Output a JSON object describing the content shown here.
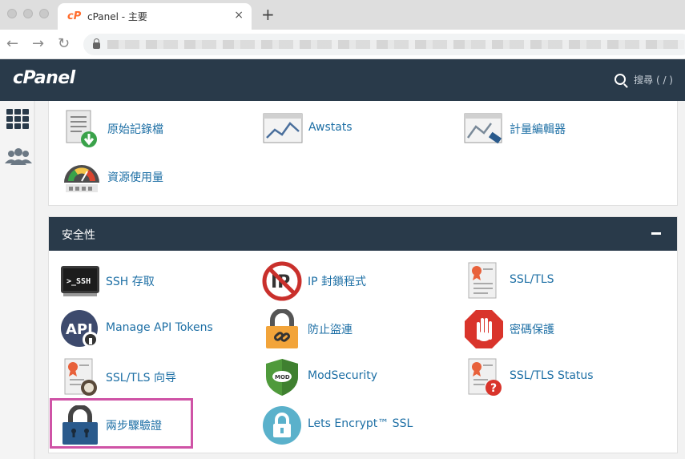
{
  "browser": {
    "tab_title": "cPanel - 主要",
    "tab_favicon": "cP",
    "tab_close": "×",
    "new_tab": "+",
    "nav": {
      "back": "←",
      "forward": "→",
      "reload": "↻"
    }
  },
  "header": {
    "logo": "cPanel",
    "search_label": "搜尋 ( / )"
  },
  "top_panel": {
    "items": [
      {
        "label": "原始記錄檔",
        "icon": "raw-log-icon"
      },
      {
        "label": "Awstats",
        "icon": "awstats-icon"
      },
      {
        "label": "計量編輯器",
        "icon": "metrics-editor-icon"
      },
      {
        "label": "資源使用量",
        "icon": "resource-usage-icon"
      }
    ]
  },
  "security": {
    "title": "安全性",
    "items": [
      {
        "label": "SSH 存取",
        "icon": "ssh-icon"
      },
      {
        "label": "IP 封鎖程式",
        "icon": "ip-blocker-icon"
      },
      {
        "label": "SSL/TLS",
        "icon": "ssl-certificate-icon"
      },
      {
        "label": "Manage API Tokens",
        "icon": "api-token-icon"
      },
      {
        "label": "防止盜連",
        "icon": "hotlink-chain-lock-icon"
      },
      {
        "label": "密碼保護",
        "icon": "stop-hand-icon"
      },
      {
        "label": "SSL/TLS 向导",
        "icon": "ssl-wizard-icon"
      },
      {
        "label": "ModSecurity",
        "icon": "modsecurity-shield-icon"
      },
      {
        "label": "SSL/TLS Status",
        "icon": "ssl-status-icon"
      },
      {
        "label": "兩步驟驗證",
        "icon": "two-factor-lock-icon"
      },
      {
        "label": "Lets Encrypt™ SSL",
        "icon": "lets-encrypt-icon"
      }
    ]
  },
  "colors": {
    "header": "#293a4a",
    "link": "#1d6fa5",
    "highlight": "#cf53a6"
  }
}
